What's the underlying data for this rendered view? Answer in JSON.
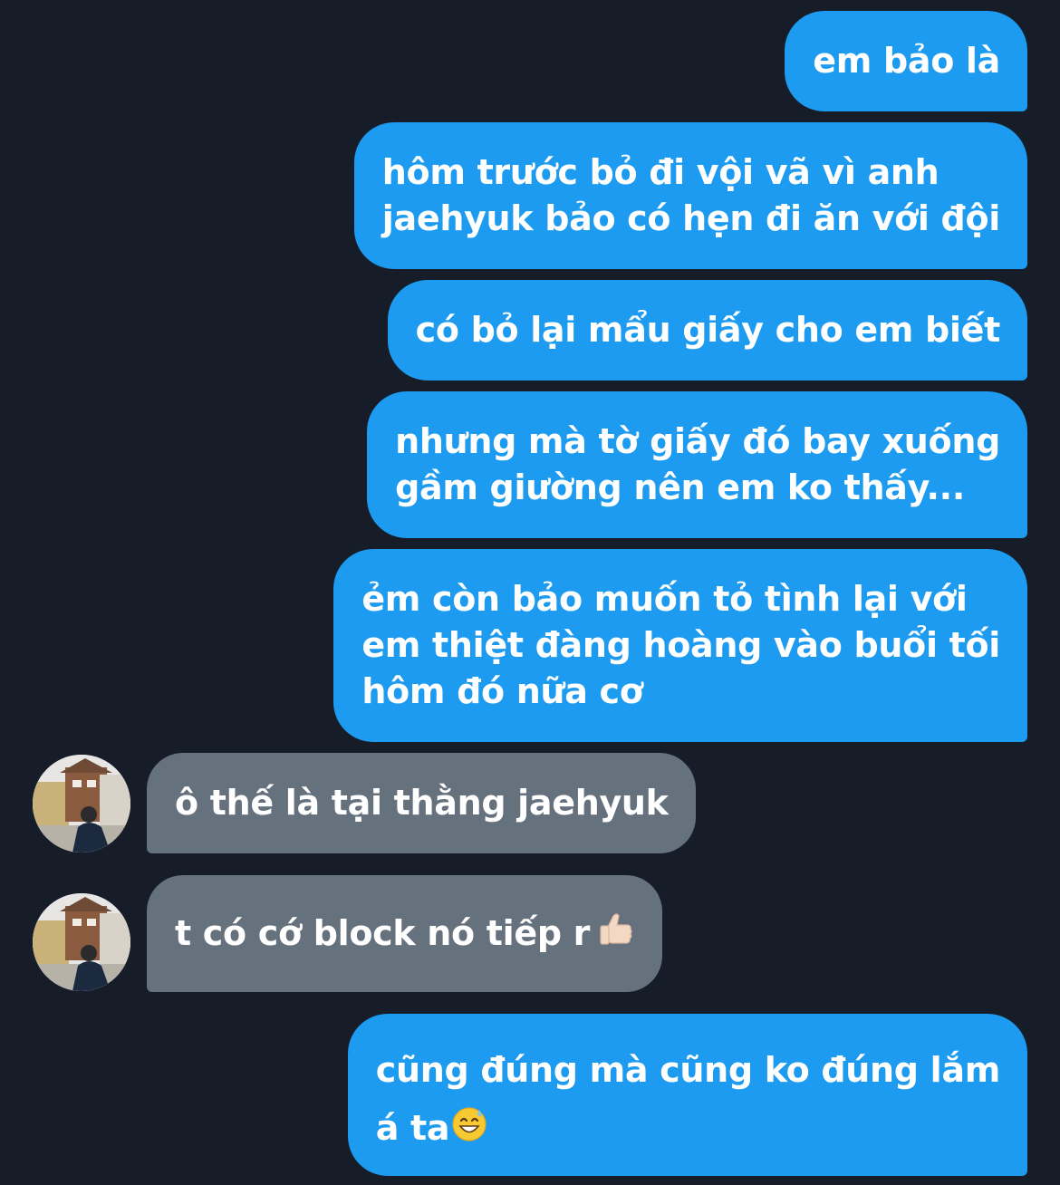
{
  "conversation": {
    "messages": [
      {
        "direction": "sent",
        "lines": [
          "em bảo là"
        ]
      },
      {
        "direction": "sent",
        "lines": [
          "hôm trước bỏ đi vội vã vì anh",
          "jaehyuk bảo có hẹn đi ăn với đội"
        ]
      },
      {
        "direction": "sent",
        "lines": [
          "có bỏ lại mẩu giấy cho em biết"
        ]
      },
      {
        "direction": "sent",
        "lines": [
          "nhưng mà tờ giấy đó bay xuống",
          "gầm giường nên em ko thấy..."
        ]
      },
      {
        "direction": "sent",
        "lines": [
          "ẻm còn bảo muốn tỏ tình lại với",
          "em thiệt đàng hoàng vào buổi tối",
          "hôm đó nữa cơ"
        ]
      },
      {
        "direction": "received",
        "lines": [
          "ô thế là tại thằng jaehyuk"
        ],
        "avatar_icon": "profile-photo"
      },
      {
        "direction": "received",
        "lines": [
          "t có cớ block nó tiếp r"
        ],
        "emoji_icon": "thumbs-up-emoji",
        "avatar_icon": "profile-photo"
      },
      {
        "direction": "sent",
        "lines": [
          "cũng đúng mà cũng ko đúng lắm",
          "á ta"
        ],
        "emoji_icon": "sweat-smile-emoji"
      }
    ]
  },
  "colors": {
    "background": "#161d28",
    "sent_bubble": "#1d9bf0",
    "received_bubble": "#66717e",
    "text": "#ffffff"
  }
}
